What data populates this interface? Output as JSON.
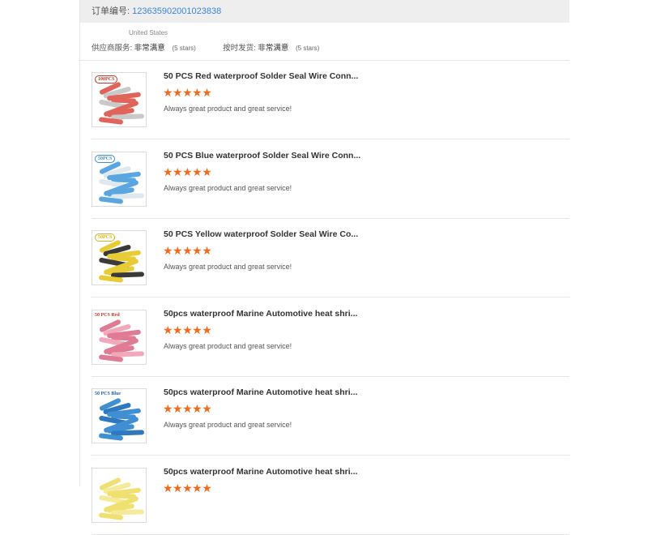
{
  "order": {
    "label": "订单编号:",
    "number": "123635902001023838"
  },
  "buyer": {
    "country": "United States"
  },
  "seller_ratings": [
    {
      "label": "供应商服务:",
      "value": "非常满意",
      "note": "(5 stars)"
    },
    {
      "label": "按时发货:",
      "value": "非常满意",
      "note": "(5 stars)"
    }
  ],
  "colors": {
    "star": "#f26b1d",
    "link": "#3a86d8",
    "order_bar_bg": "#eeeeee"
  },
  "items": [
    {
      "title": "50 PCS Red waterproof Solder Seal Wire Conn...",
      "stars": "★★★★★",
      "rating": 5,
      "comment": "Always great product and great service!",
      "tag": "100PCS",
      "tag_color": "#c0392b",
      "tube_color": "#e0645a",
      "accent": "#c9c9c9"
    },
    {
      "title": "50 PCS Blue waterproof Solder Seal Wire Conn...",
      "stars": "★★★★★",
      "rating": 5,
      "comment": "Always great product and great service!",
      "tag": "50PCS",
      "tag_color": "#3a8fd6",
      "tube_color": "#5aa6e0",
      "accent": "#e0e8ef"
    },
    {
      "title": "50 PCS Yellow waterproof Solder Seal Wire Co...",
      "stars": "★★★★★",
      "rating": 5,
      "comment": "Always great product and great service!",
      "tag": "50PCS",
      "tag_color": "#d4b21c",
      "tube_color": "#e8cc36",
      "accent": "#3a3a3a"
    },
    {
      "title": "50pcs waterproof Marine Automotive heat shri...",
      "stars": "★★★★★",
      "rating": 5,
      "comment": "Always great product and great service!",
      "tag": "50 PCS Red",
      "tag_color": "#c0392b",
      "tube_color": "#e07b96",
      "accent": "#f2a8bb"
    },
    {
      "title": "50pcs waterproof Marine Automotive heat shri...",
      "stars": "★★★★★",
      "rating": 5,
      "comment": "Always great product and great service!",
      "tag": "50 PCS Blue",
      "tag_color": "#1f5fa8",
      "tube_color": "#3f8fd2",
      "accent": "#2e78c0"
    },
    {
      "title": "50pcs waterproof Marine Automotive heat shri...",
      "stars": "★★★★★",
      "rating": 5,
      "comment": "",
      "tag": "",
      "tag_color": "#c9b400",
      "tube_color": "#f0e070",
      "accent": "#f5ea9a"
    }
  ]
}
